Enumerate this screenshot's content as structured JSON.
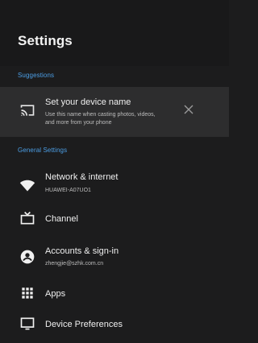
{
  "header": {
    "title": "Settings"
  },
  "sections": {
    "suggestions": "Suggestions",
    "general": "General Settings"
  },
  "suggestion": {
    "title": "Set your device name",
    "desc_line1": "Use this name when casting photos, videos,",
    "desc_line2": "and more from your phone",
    "icon": "cast-icon",
    "dismiss_icon": "close-icon"
  },
  "items": [
    {
      "label": "Network & internet",
      "sub": "HUAWEI-A07UO1",
      "icon": "wifi-icon"
    },
    {
      "label": "Channel",
      "sub": "",
      "icon": "tv-icon"
    },
    {
      "label": "Accounts & sign-in",
      "sub": "zhengjie@szhk.com.cn",
      "icon": "account-icon"
    },
    {
      "label": "Apps",
      "sub": "",
      "icon": "apps-grid-icon"
    },
    {
      "label": "Device Preferences",
      "sub": "",
      "icon": "monitor-icon"
    }
  ],
  "colors": {
    "background": "#1c1c1d",
    "card": "#2d2d2e",
    "accent": "#4c9fe6"
  }
}
